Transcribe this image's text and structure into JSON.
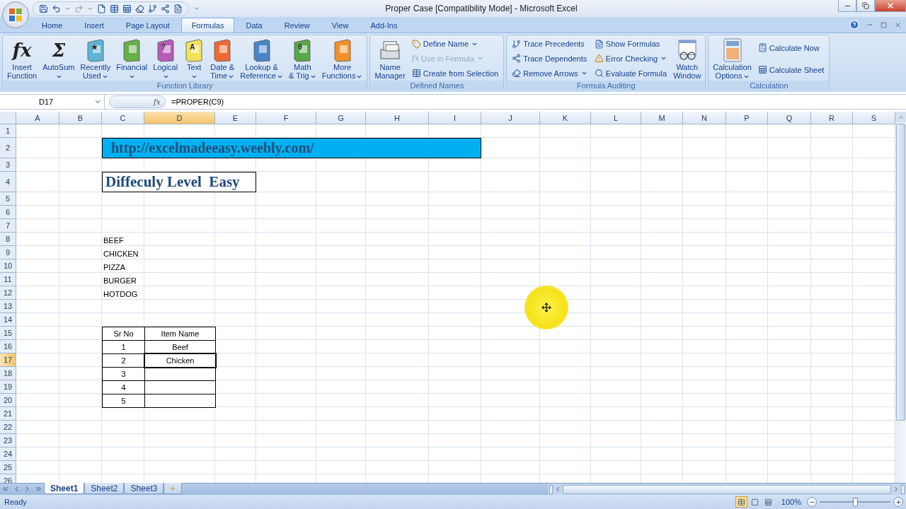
{
  "window": {
    "title": "Proper Case  [Compatibility Mode] - Microsoft Excel"
  },
  "ribbon_tabs": [
    {
      "label": "Home",
      "selected": false
    },
    {
      "label": "Insert",
      "selected": false
    },
    {
      "label": "Page Layout",
      "selected": false
    },
    {
      "label": "Formulas",
      "selected": true
    },
    {
      "label": "Data",
      "selected": false
    },
    {
      "label": "Review",
      "selected": false
    },
    {
      "label": "View",
      "selected": false
    },
    {
      "label": "Add-Ins",
      "selected": false
    }
  ],
  "ribbon_groups": [
    {
      "title": "Function Library",
      "items": [
        {
          "kind": "glyph",
          "lines": [
            "Insert",
            "Function"
          ],
          "glyph": "fx",
          "dropdown": false,
          "disabled": false
        },
        {
          "kind": "glyph",
          "lines": [
            "AutoSum"
          ],
          "glyph": "Σ",
          "dropdown": true,
          "disabled": false
        },
        {
          "kind": "book",
          "lines": [
            "Recently",
            "Used"
          ],
          "color": "#5fb4d6",
          "glyph": "★",
          "dropdown": true,
          "disabled": false
        },
        {
          "kind": "book",
          "lines": [
            "Financial"
          ],
          "color": "#6aae4a",
          "dropdown": true,
          "disabled": false
        },
        {
          "kind": "book",
          "lines": [
            "Logical"
          ],
          "color": "#b45cb8",
          "glyph": "?",
          "dropdown": true,
          "disabled": false
        },
        {
          "kind": "book",
          "lines": [
            "Text"
          ],
          "color": "#f2e35a",
          "glyph": "A",
          "dropdown": true,
          "disabled": false
        },
        {
          "kind": "book",
          "lines": [
            "Date &",
            "Time"
          ],
          "color": "#ee6a32",
          "dropdown": true,
          "disabled": false
        },
        {
          "kind": "book",
          "lines": [
            "Lookup &",
            "Reference"
          ],
          "color": "#4a84c6",
          "dropdown": true,
          "disabled": false
        },
        {
          "kind": "book",
          "lines": [
            "Math",
            "& Trig"
          ],
          "color": "#58a64a",
          "glyph": "θ",
          "dropdown": true,
          "disabled": false
        },
        {
          "kind": "book",
          "lines": [
            "More",
            "Functions"
          ],
          "color": "#f29028",
          "dropdown": true,
          "disabled": false
        }
      ]
    },
    {
      "title": "Defined Names",
      "items": [
        {
          "kind": "card-file",
          "lines": [
            "Name",
            "Manager"
          ],
          "dropdown": false,
          "disabled": false
        },
        {
          "kind": "small",
          "label": "Define Name",
          "dropdown": true,
          "disabled": false
        },
        {
          "kind": "small",
          "label": "Use in Formula",
          "glyph": "fx",
          "dropdown": true,
          "disabled": true
        },
        {
          "kind": "small",
          "label": "Create from Selection",
          "dropdown": false,
          "disabled": false
        }
      ]
    },
    {
      "title": "Formula Auditing",
      "items": [
        {
          "kind": "small",
          "label": "Trace Precedents",
          "dropdown": false,
          "disabled": false
        },
        {
          "kind": "small",
          "label": "Trace Dependents",
          "dropdown": false,
          "disabled": false
        },
        {
          "kind": "small",
          "label": "Remove Arrows",
          "dropdown": true,
          "disabled": false
        },
        {
          "kind": "small",
          "label": "Show Formulas",
          "dropdown": false,
          "disabled": false
        },
        {
          "kind": "small",
          "label": "Error Checking",
          "dropdown": true,
          "disabled": false
        },
        {
          "kind": "small",
          "label": "Evaluate Formula",
          "dropdown": false,
          "disabled": false
        },
        {
          "kind": "watch",
          "lines": [
            "Watch",
            "Window"
          ],
          "dropdown": false,
          "disabled": false
        }
      ]
    },
    {
      "title": "Calculation",
      "items": [
        {
          "kind": "calculator",
          "lines": [
            "Calculation",
            "Options"
          ],
          "dropdown": true,
          "disabled": false
        },
        {
          "kind": "small",
          "label": "Calculate Now",
          "dropdown": false,
          "disabled": false
        },
        {
          "kind": "small",
          "label": "Calculate Sheet",
          "dropdown": false,
          "disabled": false
        }
      ]
    }
  ],
  "name_box": "D17",
  "function_button": "fx",
  "formula": "=PROPER(C9)",
  "columns": [
    {
      "label": "A",
      "selected": false
    },
    {
      "label": "B",
      "selected": false
    },
    {
      "label": "C",
      "selected": false
    },
    {
      "label": "D",
      "selected": true
    },
    {
      "label": "E",
      "selected": false
    },
    {
      "label": "F",
      "selected": false
    },
    {
      "label": "G",
      "selected": false
    },
    {
      "label": "H",
      "selected": false
    },
    {
      "label": "I",
      "selected": false
    },
    {
      "label": "J",
      "selected": false
    },
    {
      "label": "K",
      "selected": false
    },
    {
      "label": "L",
      "selected": false
    },
    {
      "label": "M",
      "selected": false
    },
    {
      "label": "N",
      "selected": false
    },
    {
      "label": "P",
      "selected": false
    },
    {
      "label": "Q",
      "selected": false
    },
    {
      "label": "R",
      "selected": false
    },
    {
      "label": "S",
      "selected": false
    }
  ],
  "rows": [
    {
      "label": "1",
      "selected": false
    },
    {
      "label": "2",
      "selected": false
    },
    {
      "label": "3",
      "selected": false
    },
    {
      "label": "4",
      "selected": false
    },
    {
      "label": "5",
      "selected": false
    },
    {
      "label": "6",
      "selected": false
    },
    {
      "label": "7",
      "selected": false
    },
    {
      "label": "8",
      "selected": false
    },
    {
      "label": "9",
      "selected": false
    },
    {
      "label": "10",
      "selected": false
    },
    {
      "label": "11",
      "selected": false
    },
    {
      "label": "12",
      "selected": false
    },
    {
      "label": "13",
      "selected": false
    },
    {
      "label": "14",
      "selected": false
    },
    {
      "label": "15",
      "selected": false
    },
    {
      "label": "16",
      "selected": false
    },
    {
      "label": "17",
      "selected": true
    },
    {
      "label": "18",
      "selected": false
    },
    {
      "label": "19",
      "selected": false
    },
    {
      "label": "20",
      "selected": false
    },
    {
      "label": "21",
      "selected": false
    },
    {
      "label": "22",
      "selected": false
    },
    {
      "label": "23",
      "selected": false
    },
    {
      "label": "24",
      "selected": false
    },
    {
      "label": "25",
      "selected": false
    },
    {
      "label": "26",
      "selected": false
    }
  ],
  "banner": "http://excelmadeeasy.weebly.com/",
  "heading": "Diffeculy Level  Easy",
  "list": [
    "BEEF",
    "CHICKEN",
    "PIZZA",
    "BURGER",
    "HOTDOG"
  ],
  "table": {
    "columns": [
      "Sr No",
      "Item Name"
    ],
    "rows": [
      {
        "cells": [
          "1",
          "Beef"
        ],
        "active": false
      },
      {
        "cells": [
          "2",
          "Chicken"
        ],
        "active": true
      },
      {
        "cells": [
          "3"
        ],
        "active": false
      },
      {
        "cells": [
          "4"
        ],
        "active": false
      },
      {
        "cells": [
          "5"
        ],
        "active": false
      }
    ]
  },
  "sheet_tabs": [
    {
      "label": "Sheet1",
      "selected": true
    },
    {
      "label": "Sheet2",
      "selected": false
    },
    {
      "label": "Sheet3",
      "selected": false
    }
  ],
  "status": "Ready",
  "view_buttons": [
    {
      "kind": "normal",
      "selected": true
    },
    {
      "kind": "page-layout",
      "selected": false
    },
    {
      "kind": "page-break",
      "selected": false
    }
  ],
  "zoom": {
    "reading": "100%",
    "level": 0.5
  }
}
